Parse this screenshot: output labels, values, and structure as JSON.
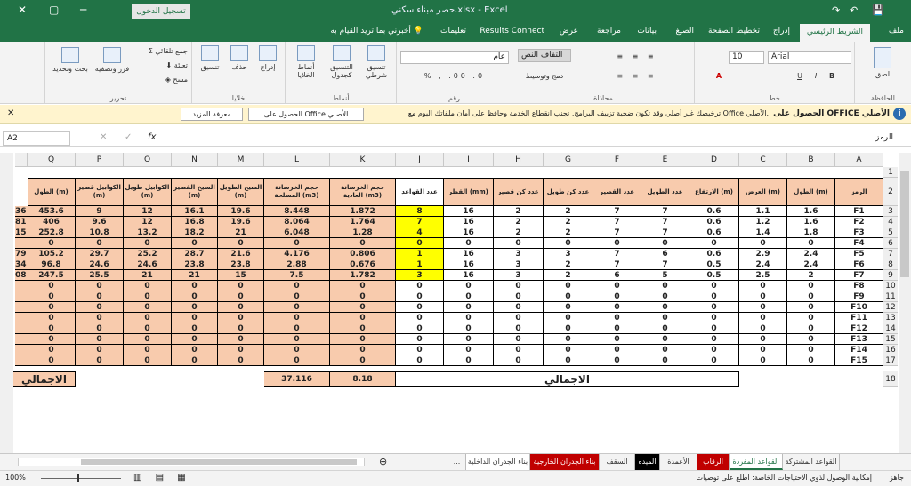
{
  "titlebar": {
    "title": "حصر مبناء سكني.xlsx  -  Excel",
    "signin": "تسجيل الدخول"
  },
  "tabs": [
    "ملف",
    "الشريط الرئيسي",
    "إدراج",
    "تخطيط الصفحة",
    "الصيغ",
    "بيانات",
    "مراجعة",
    "عرض",
    "Results Connect",
    "تعليمات",
    "أخبرني بما تريد القيام به"
  ],
  "ribbon": {
    "font_name": "Arial",
    "font_size": "10",
    "number_format": "عام",
    "wrap": "التفاف النص",
    "merge": "دمج وتوسيط",
    "autosum": "جمع تلقائي",
    "fill": "تعبئة",
    "clear": "مسح",
    "sort": "فرز وتصفية",
    "find": "بحث وتحديد",
    "insert": "إدراج",
    "delete": "حذف",
    "format": "تنسيق",
    "cond_fmt": "تنسيق شرطي",
    "fmt_table": "التنسيق كجدول",
    "styles": "أنماط الخلايا",
    "paste": "لصق",
    "groups": {
      "clipboard": "الحافظة",
      "font": "خط",
      "align": "محاذاة",
      "number": "رقم",
      "styles": "أنماط",
      "cells": "خلايا",
      "edit": "تحرير"
    }
  },
  "msgbar": {
    "title": "الحصول على OFFICE الأصلي",
    "text": "ترخيصك غير أصلي وقد تكون ضحية تزييف البرامج. تجنب انقطاع الخدمة وحافظ على أمان ملفاتك اليوم مع Office الأصلي.",
    "btn1": "الحصول على Office الأصلي",
    "btn2": "معرفة المزيد"
  },
  "formula": {
    "namebox": "A2",
    "value": "الرمز"
  },
  "columns": [
    "A",
    "B",
    "C",
    "D",
    "E",
    "F",
    "G",
    "H",
    "I",
    "J",
    "K",
    "L",
    "M",
    "N",
    "O",
    "P",
    "Q",
    ""
  ],
  "header_row": [
    "الرمز",
    "الطول (m)",
    "العرض (m)",
    "الارتفاع (m)",
    "عدد الطويل",
    "عدد القصير",
    "عدد كن طويل",
    "عدد كن قصير",
    "القطر (mm)",
    "عدد القواعد",
    "حجم الخرسانة العادية (m3)",
    "حجم الخرسانة المسلحة (m3)",
    "السيخ الطويل (m)",
    "السيخ القصير (m)",
    "الكوابيل طويل (m)",
    "الكوابيل قصير (m)",
    "الطول (m)",
    ""
  ],
  "rows": [
    [
      "F1",
      "1.6",
      "1.1",
      "0.6",
      "7",
      "7",
      "2",
      "2",
      "16",
      "8",
      "1.872",
      "8.448",
      "19.6",
      "16.1",
      "12",
      "9",
      "453.6",
      "36"
    ],
    [
      "F2",
      "1.6",
      "1.2",
      "0.6",
      "7",
      "7",
      "2",
      "2",
      "16",
      "7",
      "1.764",
      "8.064",
      "19.6",
      "16.8",
      "12",
      "9.6",
      "406",
      "81"
    ],
    [
      "F3",
      "1.8",
      "1.4",
      "0.6",
      "7",
      "7",
      "2",
      "2",
      "16",
      "4",
      "1.28",
      "6.048",
      "21",
      "18.2",
      "13.2",
      "10.8",
      "252.8",
      "15"
    ],
    [
      "F4",
      "0",
      "0",
      "0",
      "0",
      "0",
      "0",
      "0",
      "0",
      "0",
      "0",
      "0",
      "0",
      "0",
      "0",
      "0",
      "0",
      ""
    ],
    [
      "F5",
      "2.4",
      "2.9",
      "0.6",
      "6",
      "7",
      "3",
      "3",
      "16",
      "1",
      "0.806",
      "4.176",
      "21.6",
      "28.7",
      "25.2",
      "29.7",
      "105.2",
      "79"
    ],
    [
      "F6",
      "2.4",
      "2.4",
      "0.5",
      "7",
      "7",
      "2",
      "3",
      "16",
      "1",
      "0.676",
      "2.88",
      "23.8",
      "23.8",
      "24.6",
      "24.6",
      "96.8",
      "34"
    ],
    [
      "F7",
      "2",
      "2.5",
      "0.5",
      "5",
      "6",
      "2",
      "3",
      "16",
      "3",
      "1.782",
      "7.5",
      "15",
      "21",
      "21",
      "25.5",
      "247.5",
      "08"
    ],
    [
      "F8",
      "0",
      "0",
      "0",
      "0",
      "0",
      "0",
      "0",
      "0",
      "0",
      "0",
      "0",
      "0",
      "0",
      "0",
      "0",
      "0",
      ""
    ],
    [
      "F9",
      "0",
      "0",
      "0",
      "0",
      "0",
      "0",
      "0",
      "0",
      "0",
      "0",
      "0",
      "0",
      "0",
      "0",
      "0",
      "0",
      ""
    ],
    [
      "F10",
      "0",
      "0",
      "0",
      "0",
      "0",
      "0",
      "0",
      "0",
      "0",
      "0",
      "0",
      "0",
      "0",
      "0",
      "0",
      "0",
      ""
    ],
    [
      "F11",
      "0",
      "0",
      "0",
      "0",
      "0",
      "0",
      "0",
      "0",
      "0",
      "0",
      "0",
      "0",
      "0",
      "0",
      "0",
      "0",
      ""
    ],
    [
      "F12",
      "0",
      "0",
      "0",
      "0",
      "0",
      "0",
      "0",
      "0",
      "0",
      "0",
      "0",
      "0",
      "0",
      "0",
      "0",
      "0",
      ""
    ],
    [
      "F13",
      "0",
      "0",
      "0",
      "0",
      "0",
      "0",
      "0",
      "0",
      "0",
      "0",
      "0",
      "0",
      "0",
      "0",
      "0",
      "0",
      ""
    ],
    [
      "F14",
      "0",
      "0",
      "0",
      "0",
      "0",
      "0",
      "0",
      "0",
      "0",
      "0",
      "0",
      "0",
      "0",
      "0",
      "0",
      "0",
      ""
    ],
    [
      "F15",
      "0",
      "0",
      "0",
      "0",
      "0",
      "0",
      "0",
      "0",
      "0",
      "0",
      "0",
      "0",
      "0",
      "0",
      "0",
      "0",
      ""
    ]
  ],
  "total": {
    "label": "الاجمالي",
    "K": "8.18",
    "L": "37.116",
    "label2": "الاجمالي"
  },
  "sheets": [
    "القواعد المشتركة",
    "القواعد المفردة",
    "الرقاب",
    "الأعمدة",
    "الميده",
    "السقف",
    "بناء الجدران الخارجية",
    "بناء الجدران الداخلية",
    "..."
  ],
  "status": {
    "ready": "جاهز",
    "access": "إمكانية الوصول لذوي الاحتياجات الخاصة: اطلع على توصيات",
    "zoom": "100%"
  },
  "colors": {
    "excel_green": "#217346",
    "peach": "#f8cbad",
    "yellow": "#ffff00"
  }
}
